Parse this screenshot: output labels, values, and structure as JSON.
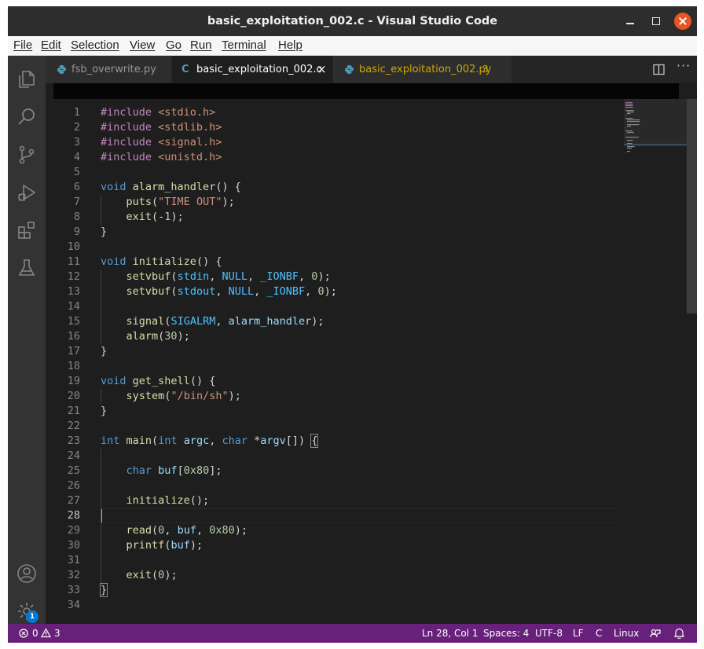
{
  "window": {
    "title": "basic_exploitation_002.c - Visual Studio Code"
  },
  "menu": [
    "File",
    "Edit",
    "Selection",
    "View",
    "Go",
    "Run",
    "Terminal",
    "Help"
  ],
  "activity_bar": {
    "items": [
      "explorer-icon",
      "search-icon",
      "source-control-icon",
      "run-debug-icon",
      "extensions-icon",
      "testing-icon"
    ],
    "bottom": [
      "accounts-icon",
      "manage-gear-icon"
    ],
    "manage_badge": "1"
  },
  "tabs": [
    {
      "label": "fsb_overwrite.py",
      "icon": "python-icon",
      "active": false
    },
    {
      "label": "basic_exploitation_002.c",
      "icon": "c-file-icon",
      "icon_text": "C",
      "active": true,
      "close": "×"
    },
    {
      "label": "basic_exploitation_002.py",
      "icon": "python-icon",
      "active": false,
      "problems": "3"
    }
  ],
  "editor_actions": {
    "more": "···"
  },
  "editor": {
    "language": "C",
    "active_line": 28,
    "line_numbers": [
      "1",
      "2",
      "3",
      "4",
      "5",
      "6",
      "7",
      "8",
      "9",
      "10",
      "11",
      "12",
      "13",
      "14",
      "15",
      "16",
      "17",
      "18",
      "19",
      "20",
      "21",
      "22",
      "23",
      "24",
      "25",
      "26",
      "27",
      "28",
      "29",
      "30",
      "31",
      "32",
      "33",
      "34"
    ],
    "lines": [
      "#include <stdio.h>",
      "#include <stdlib.h>",
      "#include <signal.h>",
      "#include <unistd.h>",
      "",
      "void alarm_handler() {",
      "    puts(\"TIME OUT\");",
      "    exit(-1);",
      "}",
      "",
      "void initialize() {",
      "    setvbuf(stdin, NULL, _IONBF, 0);",
      "    setvbuf(stdout, NULL, _IONBF, 0);",
      "",
      "    signal(SIGALRM, alarm_handler);",
      "    alarm(30);",
      "}",
      "",
      "void get_shell() {",
      "    system(\"/bin/sh\");",
      "}",
      "",
      "int main(int argc, char *argv[]) {",
      "",
      "    char buf[0x80];",
      "",
      "    initialize();",
      "",
      "    read(0, buf, 0x80);",
      "    printf(buf);",
      "",
      "    exit(0);",
      "}",
      ""
    ]
  },
  "status_bar": {
    "errors": "0",
    "warnings": "3",
    "position": "Ln 28, Col 1",
    "indent": "Spaces: 4",
    "encoding": "UTF-8",
    "eol": "LF",
    "language": "C",
    "platform": "Linux"
  },
  "colors": {
    "status_bar": "#68217a",
    "title_close": "#e95420",
    "modified_tab": "#cca700"
  }
}
